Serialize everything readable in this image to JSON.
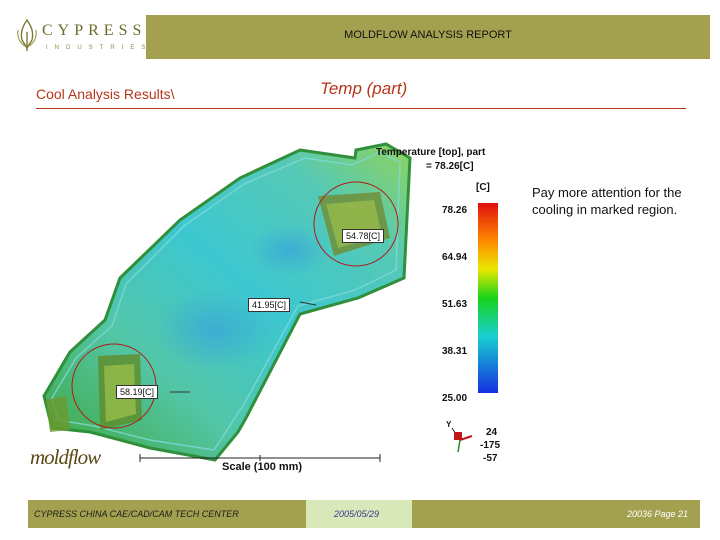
{
  "brand": {
    "name": "CYPRESS",
    "sub": "INDUSTRIES"
  },
  "header": {
    "title": "MOLDFLOW  ANALYSIS REPORT"
  },
  "slide": {
    "section": "Cool Analysis Results\\",
    "title": "Temp (part)"
  },
  "plot": {
    "legend_title_line1": "Temperature [top], part",
    "legend_title_line2": "= 78.26[C]",
    "unit": "[C]",
    "ticks": [
      "78.26",
      "64.94",
      "51.63",
      "38.31",
      "25.00"
    ],
    "callouts": [
      "54.78[C]",
      "41.95[C]",
      "58.19[C]"
    ],
    "orientation": [
      "24",
      "-175",
      "-57"
    ],
    "orientation_axis": "Y",
    "scale": "Scale (100 mm)",
    "software_logo": "moldflow"
  },
  "note": "Pay more attention for the cooling in marked region.",
  "footer": {
    "center": "CYPRESS CHINA CAE/CAD/CAM TECH CENTER",
    "date": "2005/05/29",
    "page": "20036  Page 21"
  }
}
